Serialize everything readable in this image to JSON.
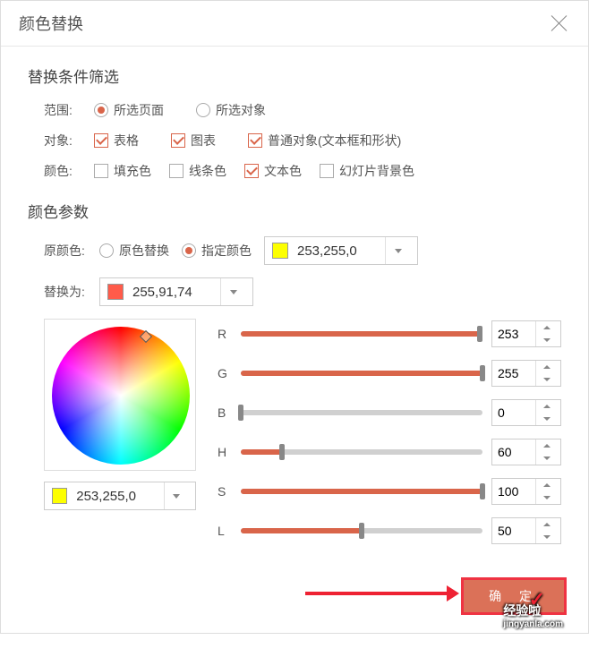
{
  "title": "颜色替换",
  "section1": "替换条件筛选",
  "labels": {
    "scope": "范围:",
    "object": "对象:",
    "color": "颜色:",
    "origColor": "原颜色:",
    "replaceWith": "替换为:"
  },
  "scope": {
    "selectedPages": "所选页面",
    "selectedObjects": "所选对象"
  },
  "objects": {
    "table": "表格",
    "chart": "图表",
    "normal": "普通对象(文本框和形状)"
  },
  "colors": {
    "fill": "填充色",
    "line": "线条色",
    "text": "文本色",
    "slideBg": "幻灯片背景色"
  },
  "section2": "颜色参数",
  "origMode": {
    "replaceOriginal": "原色替换",
    "specifyColor": "指定颜色"
  },
  "origColorValue": "253,255,0",
  "origColorHex": "#fdff00",
  "replaceColorValue": "255,91,74",
  "replaceColorHex": "#ff5b4a",
  "pickerValue": "253,255,0",
  "pickerHex": "#fdff00",
  "channels": [
    {
      "label": "R",
      "value": "253",
      "pct": 99
    },
    {
      "label": "G",
      "value": "255",
      "pct": 100
    },
    {
      "label": "B",
      "value": "0",
      "pct": 0
    },
    {
      "label": "H",
      "value": "60",
      "pct": 17
    },
    {
      "label": "S",
      "value": "100",
      "pct": 100
    },
    {
      "label": "L",
      "value": "50",
      "pct": 50
    }
  ],
  "okButton": "确 定",
  "watermark": "经验啦",
  "watermarkSub": "jingyanla.com"
}
